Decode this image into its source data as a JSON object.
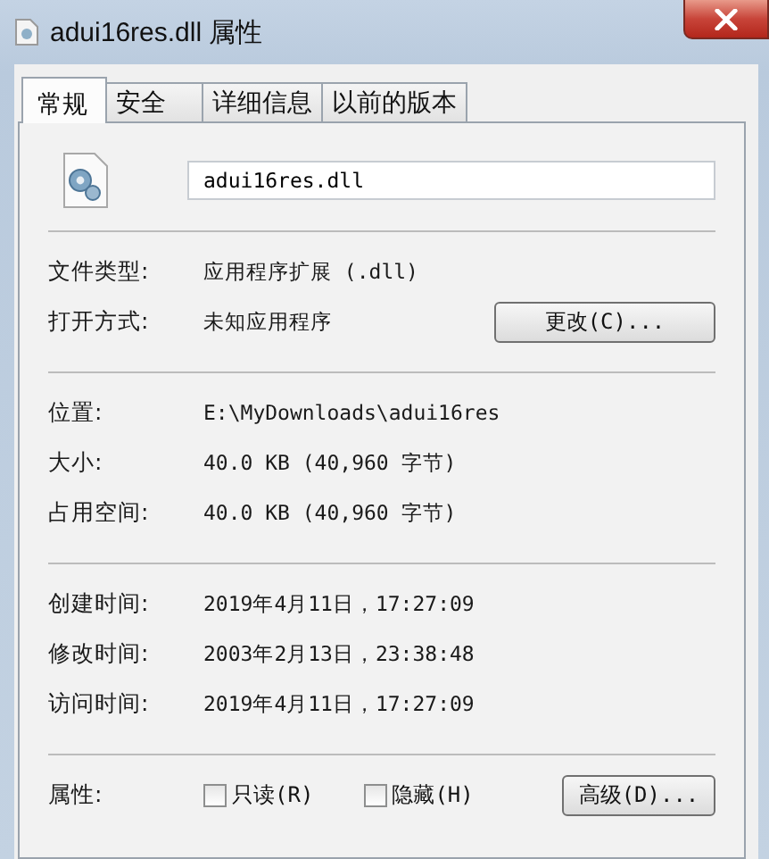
{
  "window": {
    "title": "adui16res.dll 属性"
  },
  "tabs": [
    {
      "label": "常规",
      "selected": true
    },
    {
      "label": "安全",
      "selected": false
    },
    {
      "label": "详细信息",
      "selected": false
    },
    {
      "label": "以前的版本",
      "selected": false
    }
  ],
  "file": {
    "name": "adui16res.dll"
  },
  "sections": [
    {
      "rows": [
        {
          "label": "文件类型:",
          "value": "应用程序扩展 (.dll)"
        },
        {
          "label": "打开方式:",
          "value": "未知应用程序",
          "button": "更改(C)..."
        }
      ]
    },
    {
      "rows": [
        {
          "label": "位置:",
          "value": "E:\\MyDownloads\\adui16res"
        },
        {
          "label": "大小:",
          "value": "40.0 KB (40,960 字节)"
        },
        {
          "label": "占用空间:",
          "value": "40.0 KB (40,960 字节)"
        }
      ]
    },
    {
      "rows": [
        {
          "label": "创建时间:",
          "value": "2019年4月11日，17:27:09"
        },
        {
          "label": "修改时间:",
          "value": "2003年2月13日，23:38:48"
        },
        {
          "label": "访问时间:",
          "value": "2019年4月11日，17:27:09"
        }
      ]
    }
  ],
  "attributes": {
    "label": "属性:",
    "checkboxes": [
      {
        "label": "只读(R)",
        "checked": false
      },
      {
        "label": "隐藏(H)",
        "checked": false
      }
    ],
    "button": "高级(D)..."
  }
}
